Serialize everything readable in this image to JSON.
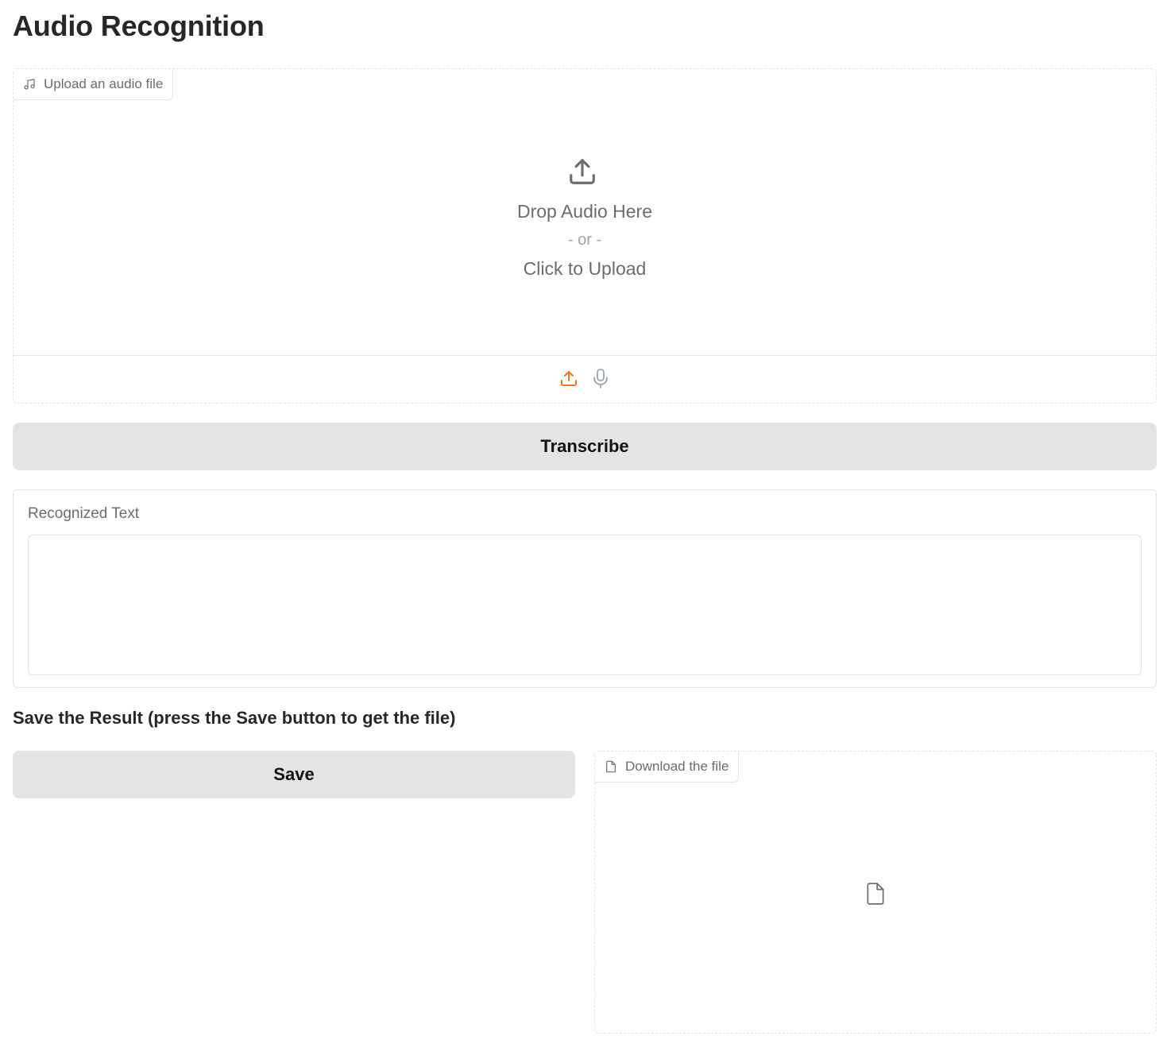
{
  "page": {
    "title": "Audio Recognition"
  },
  "audio_input": {
    "label": "Upload an audio file",
    "label_icon": "music-icon",
    "drop_text": "Drop Audio Here",
    "or_text": "- or -",
    "click_text": "Click to Upload",
    "sources": [
      {
        "name": "upload-source",
        "icon": "upload-icon",
        "active": true
      },
      {
        "name": "microphone-source",
        "icon": "microphone-icon",
        "active": false
      }
    ],
    "active_color": "#f97316"
  },
  "transcribe_button": {
    "label": "Transcribe"
  },
  "recognized_text": {
    "label": "Recognized Text",
    "value": ""
  },
  "save_section": {
    "heading": "Save the Result (press the Save button to get the file)",
    "save_button_label": "Save",
    "download_label": "Download the file",
    "download_icon": "file-icon"
  },
  "colors": {
    "button_bg": "#e4e4e7",
    "border": "#e4e4e7",
    "muted_text": "#6b6b73"
  }
}
